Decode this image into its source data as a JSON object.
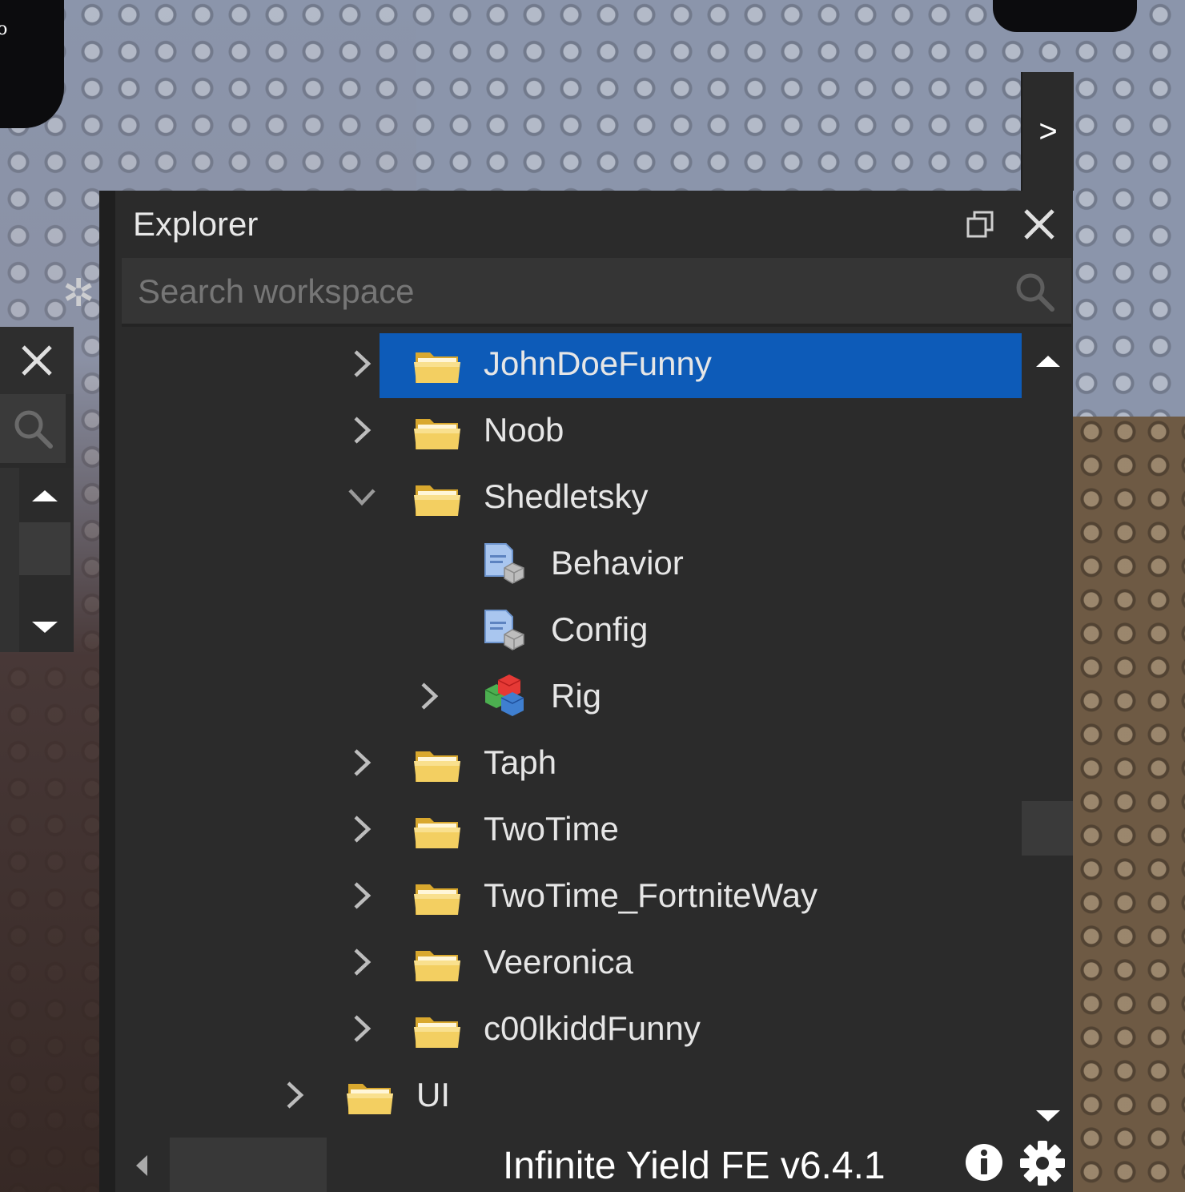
{
  "background": {
    "corner_text": "do"
  },
  "side_tab": {
    "label": ">"
  },
  "explorer": {
    "title": "Explorer",
    "search": {
      "placeholder": "Search workspace",
      "value": ""
    },
    "tree": [
      {
        "label": "JohnDoeFunny",
        "icon": "folder-icon",
        "chevron": "collapsed",
        "selected": true
      },
      {
        "label": "Noob",
        "icon": "folder-icon",
        "chevron": "collapsed",
        "selected": false
      },
      {
        "label": "Shedletsky",
        "icon": "folder-icon",
        "chevron": "expanded",
        "selected": false
      },
      {
        "label": "Behavior",
        "icon": "module-script-icon",
        "chevron": "none",
        "selected": false
      },
      {
        "label": "Config",
        "icon": "module-script-icon",
        "chevron": "none",
        "selected": false
      },
      {
        "label": "Rig",
        "icon": "model-icon",
        "chevron": "collapsed",
        "selected": false
      },
      {
        "label": "Taph",
        "icon": "folder-icon",
        "chevron": "collapsed",
        "selected": false
      },
      {
        "label": "TwoTime",
        "icon": "folder-icon",
        "chevron": "collapsed",
        "selected": false
      },
      {
        "label": "TwoTime_FortniteWay",
        "icon": "folder-icon",
        "chevron": "collapsed",
        "selected": false
      },
      {
        "label": "Veeronica",
        "icon": "folder-icon",
        "chevron": "collapsed",
        "selected": false
      },
      {
        "label": "c00lkiddFunny",
        "icon": "folder-icon",
        "chevron": "collapsed",
        "selected": false
      },
      {
        "label": "UI",
        "icon": "folder-icon",
        "chevron": "collapsed",
        "selected": false
      }
    ],
    "footer": {
      "text": "Infinite Yield FE v6.4.1"
    }
  },
  "colors": {
    "panel": "#2b2b2b",
    "selection": "#0d5bb8",
    "text": "#e6e6e6"
  }
}
